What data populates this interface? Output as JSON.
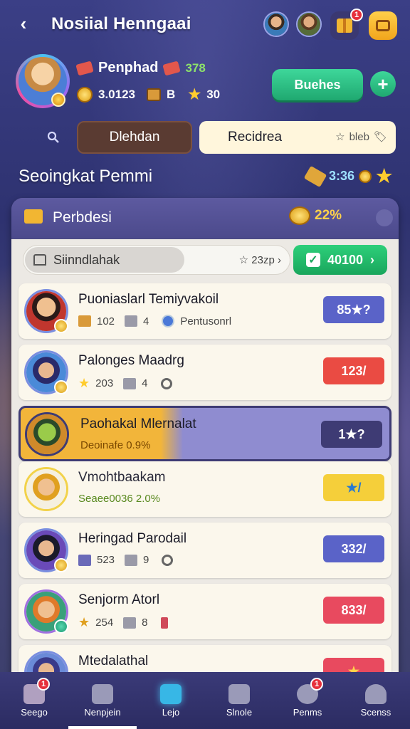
{
  "header": {
    "title": "Nosiial Henngaai",
    "gift_badge": "1"
  },
  "profile": {
    "name": "Penphad",
    "level_value": "378",
    "coins": "3.0123",
    "box_value": "B",
    "stars": "30",
    "boost_label": "Buehes",
    "plus_label": "+"
  },
  "tabs": {
    "tab_a": "Dlehdan",
    "tab_b": "Recidrea",
    "tab_b_sub": "bleb"
  },
  "section": {
    "title": "Seoingkat Pemmi",
    "right_value": "3:36"
  },
  "panel": {
    "title": "Perbdesi",
    "percent": "22%",
    "filter_label": "Siinndlahak",
    "filter_right": "23zp",
    "go_label": "40100"
  },
  "rows": [
    {
      "name": "Puoniaslarl Temiyvakoil",
      "meta1": "102",
      "meta2": "4",
      "meta3": "Pentusonrl",
      "badge": "85★?",
      "badge_color": "#5a63c8"
    },
    {
      "name": "Palonges Maadrg",
      "meta1": "203",
      "meta2": "4",
      "badge": "123/",
      "badge_color": "#ea4b43"
    },
    {
      "name": "Paohakal Mlernalat",
      "sub": "Deoinafe 0.9%",
      "badge": "1★?",
      "badge_color": "#3e3b74"
    },
    {
      "name": "Vmohtbaakam",
      "sub": "Seaee0036 2.0%",
      "badge": "★/",
      "badge_color": "#f5cf3a"
    },
    {
      "name": "Heringad Parodail",
      "meta1": "523",
      "meta2": "9",
      "badge": "332/",
      "badge_color": "#5a63c8"
    },
    {
      "name": "Senjorm Atorl",
      "meta1": "254",
      "meta2": "8",
      "badge": "833/",
      "badge_color": "#e84a5f"
    },
    {
      "name": "Mtedalathal",
      "badge": "★",
      "badge_color": "#e84a5f"
    }
  ],
  "nav": [
    {
      "label": "Seego",
      "badge": "1"
    },
    {
      "label": "Nenpjein"
    },
    {
      "label": "Lejo"
    },
    {
      "label": "Slnole"
    },
    {
      "label": "Penms",
      "badge": "1"
    },
    {
      "label": "Scenss"
    }
  ],
  "colors": {
    "accent_green": "#1fa870",
    "badge_blue": "#5a63c8",
    "badge_red": "#ea4b43",
    "panel_bg": "#4b4a86"
  }
}
